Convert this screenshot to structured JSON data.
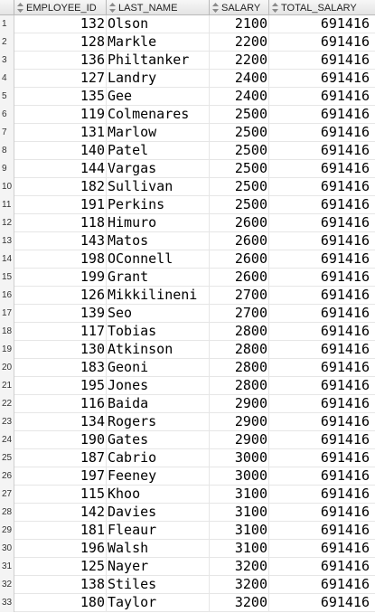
{
  "columns": [
    {
      "key": "rownum",
      "label": ""
    },
    {
      "key": "employee_id",
      "label": "EMPLOYEE_ID"
    },
    {
      "key": "last_name",
      "label": "LAST_NAME"
    },
    {
      "key": "salary",
      "label": "SALARY"
    },
    {
      "key": "total_salary",
      "label": "TOTAL_SALARY"
    }
  ],
  "header_icon": "sort-arrows-icon",
  "rows": [
    {
      "n": "1",
      "id": "132",
      "name": "Olson",
      "salary": "2100",
      "total": "691416"
    },
    {
      "n": "2",
      "id": "128",
      "name": "Markle",
      "salary": "2200",
      "total": "691416"
    },
    {
      "n": "3",
      "id": "136",
      "name": "Philtanker",
      "salary": "2200",
      "total": "691416"
    },
    {
      "n": "4",
      "id": "127",
      "name": "Landry",
      "salary": "2400",
      "total": "691416"
    },
    {
      "n": "5",
      "id": "135",
      "name": "Gee",
      "salary": "2400",
      "total": "691416"
    },
    {
      "n": "6",
      "id": "119",
      "name": "Colmenares",
      "salary": "2500",
      "total": "691416"
    },
    {
      "n": "7",
      "id": "131",
      "name": "Marlow",
      "salary": "2500",
      "total": "691416"
    },
    {
      "n": "8",
      "id": "140",
      "name": "Patel",
      "salary": "2500",
      "total": "691416"
    },
    {
      "n": "9",
      "id": "144",
      "name": "Vargas",
      "salary": "2500",
      "total": "691416"
    },
    {
      "n": "10",
      "id": "182",
      "name": "Sullivan",
      "salary": "2500",
      "total": "691416"
    },
    {
      "n": "11",
      "id": "191",
      "name": "Perkins",
      "salary": "2500",
      "total": "691416"
    },
    {
      "n": "12",
      "id": "118",
      "name": "Himuro",
      "salary": "2600",
      "total": "691416"
    },
    {
      "n": "13",
      "id": "143",
      "name": "Matos",
      "salary": "2600",
      "total": "691416"
    },
    {
      "n": "14",
      "id": "198",
      "name": "OConnell",
      "salary": "2600",
      "total": "691416"
    },
    {
      "n": "15",
      "id": "199",
      "name": "Grant",
      "salary": "2600",
      "total": "691416"
    },
    {
      "n": "16",
      "id": "126",
      "name": "Mikkilineni",
      "salary": "2700",
      "total": "691416"
    },
    {
      "n": "17",
      "id": "139",
      "name": "Seo",
      "salary": "2700",
      "total": "691416"
    },
    {
      "n": "18",
      "id": "117",
      "name": "Tobias",
      "salary": "2800",
      "total": "691416"
    },
    {
      "n": "19",
      "id": "130",
      "name": "Atkinson",
      "salary": "2800",
      "total": "691416"
    },
    {
      "n": "20",
      "id": "183",
      "name": "Geoni",
      "salary": "2800",
      "total": "691416"
    },
    {
      "n": "21",
      "id": "195",
      "name": "Jones",
      "salary": "2800",
      "total": "691416"
    },
    {
      "n": "22",
      "id": "116",
      "name": "Baida",
      "salary": "2900",
      "total": "691416"
    },
    {
      "n": "23",
      "id": "134",
      "name": "Rogers",
      "salary": "2900",
      "total": "691416"
    },
    {
      "n": "24",
      "id": "190",
      "name": "Gates",
      "salary": "2900",
      "total": "691416"
    },
    {
      "n": "25",
      "id": "187",
      "name": "Cabrio",
      "salary": "3000",
      "total": "691416"
    },
    {
      "n": "26",
      "id": "197",
      "name": "Feeney",
      "salary": "3000",
      "total": "691416"
    },
    {
      "n": "27",
      "id": "115",
      "name": "Khoo",
      "salary": "3100",
      "total": "691416"
    },
    {
      "n": "28",
      "id": "142",
      "name": "Davies",
      "salary": "3100",
      "total": "691416"
    },
    {
      "n": "29",
      "id": "181",
      "name": "Fleaur",
      "salary": "3100",
      "total": "691416"
    },
    {
      "n": "30",
      "id": "196",
      "name": "Walsh",
      "salary": "3100",
      "total": "691416"
    },
    {
      "n": "31",
      "id": "125",
      "name": "Nayer",
      "salary": "3200",
      "total": "691416"
    },
    {
      "n": "32",
      "id": "138",
      "name": "Stiles",
      "salary": "3200",
      "total": "691416"
    },
    {
      "n": "33",
      "id": "180",
      "name": "Taylor",
      "salary": "3200",
      "total": "691416"
    }
  ]
}
